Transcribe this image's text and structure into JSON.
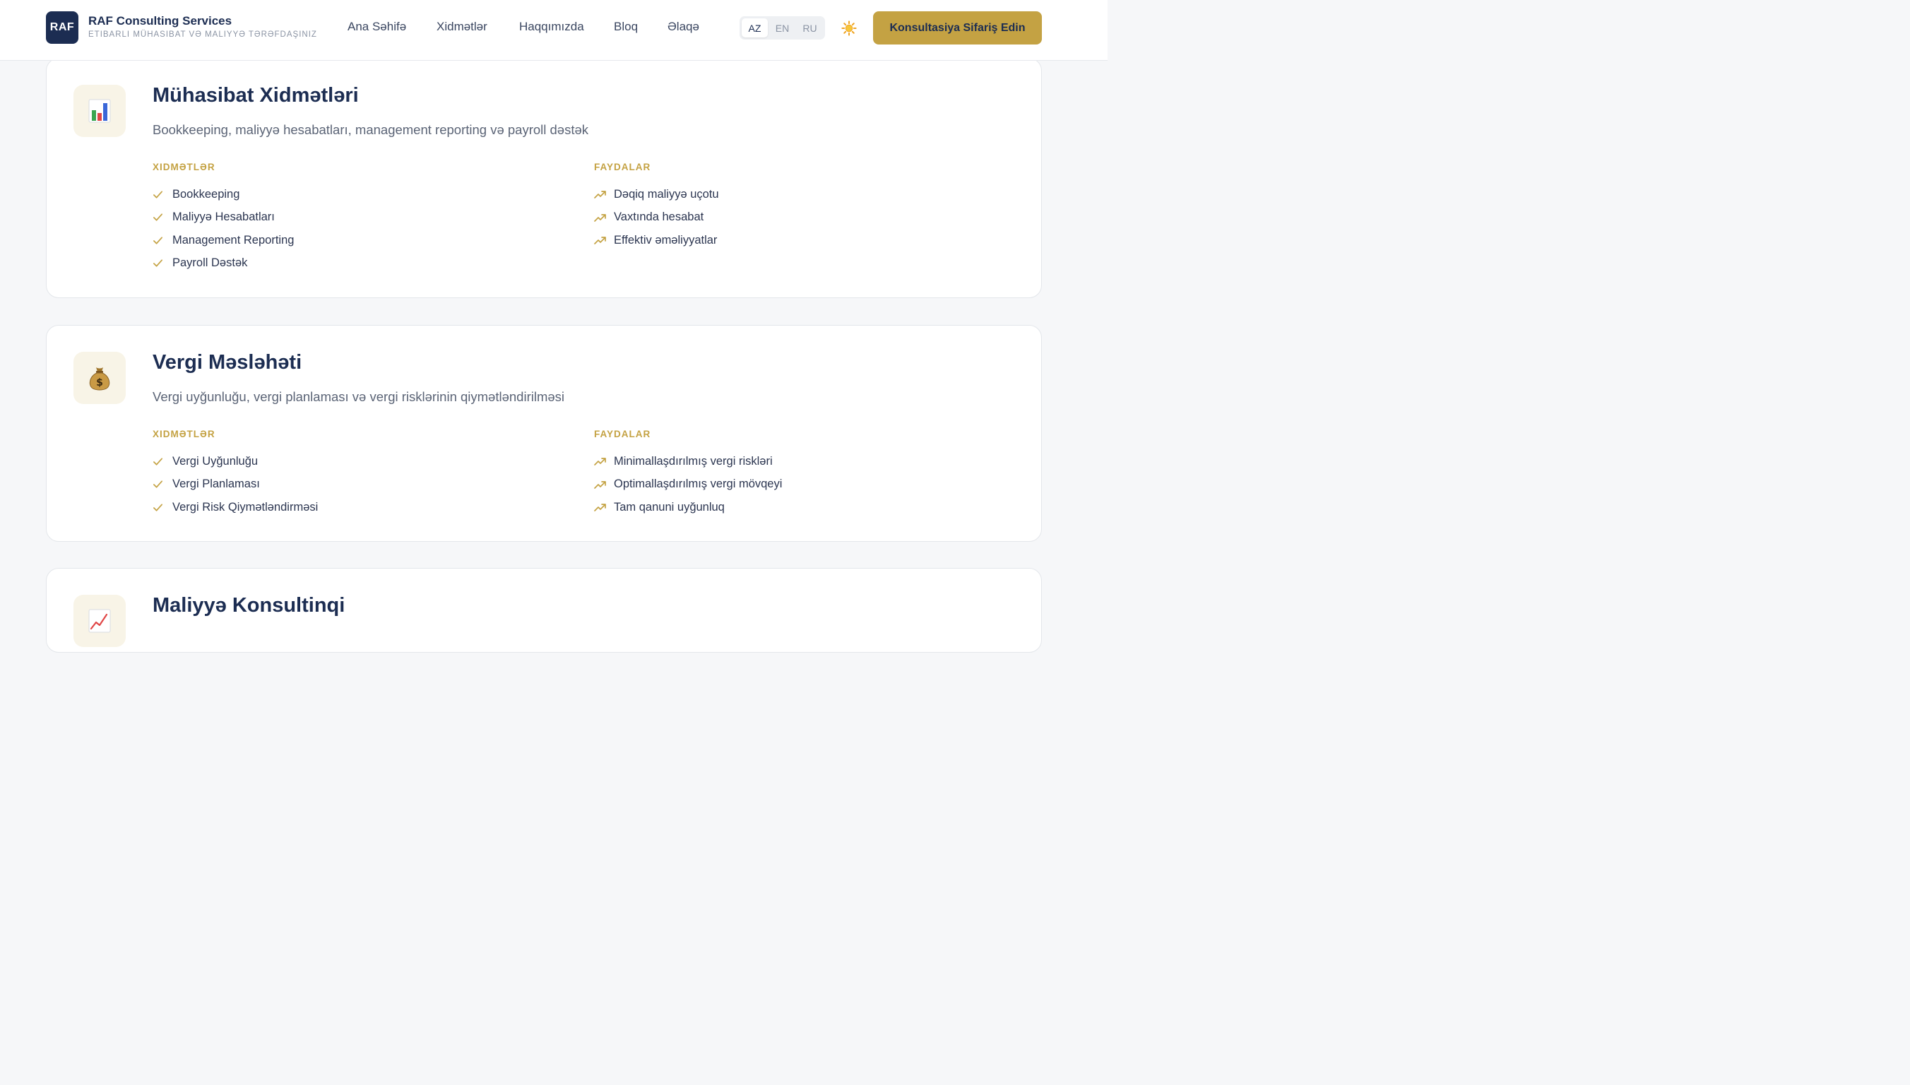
{
  "header": {
    "logo_text": "RAF",
    "brand_name": "RAF Consulting Services",
    "tagline": "ETIBARLI MÜHASIBAT VƏ MALIYYƏ TƏRƏFDAŞINIZ",
    "nav": [
      "Ana Səhifə",
      "Xidmətlər",
      "Haqqımızda",
      "Bloq",
      "Əlaqə"
    ],
    "languages": [
      "AZ",
      "EN",
      "RU"
    ],
    "active_language": "AZ",
    "theme_icon": "sun-icon",
    "cta_label": "Konsultasiya Sifariş Edin"
  },
  "colors": {
    "navy": "#1c2d52",
    "gold": "#c4a243",
    "background": "#f6f7f9"
  },
  "cards": [
    {
      "icon": "bar-chart-icon",
      "title": "Mühasibat Xidmətləri",
      "description": "Bookkeeping, maliyyə hesabatları, management reporting və payroll dəstək",
      "services_label": "XIDMƏTLƏR",
      "benefits_label": "FAYDALAR",
      "services": [
        "Bookkeeping",
        "Maliyyə Hesabatları",
        "Management Reporting",
        "Payroll Dəstək"
      ],
      "benefits": [
        "Dəqiq maliyyə uçotu",
        "Vaxtında hesabat",
        "Effektiv əməliyyatlar"
      ]
    },
    {
      "icon": "money-bag-icon",
      "title": "Vergi Məsləhəti",
      "description": "Vergi uyğunluğu, vergi planlaması və vergi risklərinin qiymətləndirilməsi",
      "services_label": "XIDMƏTLƏR",
      "benefits_label": "FAYDALAR",
      "services": [
        "Vergi Uyğunluğu",
        "Vergi Planlaması",
        "Vergi Risk Qiymətləndirməsi"
      ],
      "benefits": [
        "Minimallaşdırılmış vergi riskləri",
        "Optimallaşdırılmış vergi mövqeyi",
        "Tam qanuni uyğunluq"
      ]
    },
    {
      "icon": "trend-chart-icon",
      "title": "Maliyyə Konsultinqi"
    }
  ]
}
